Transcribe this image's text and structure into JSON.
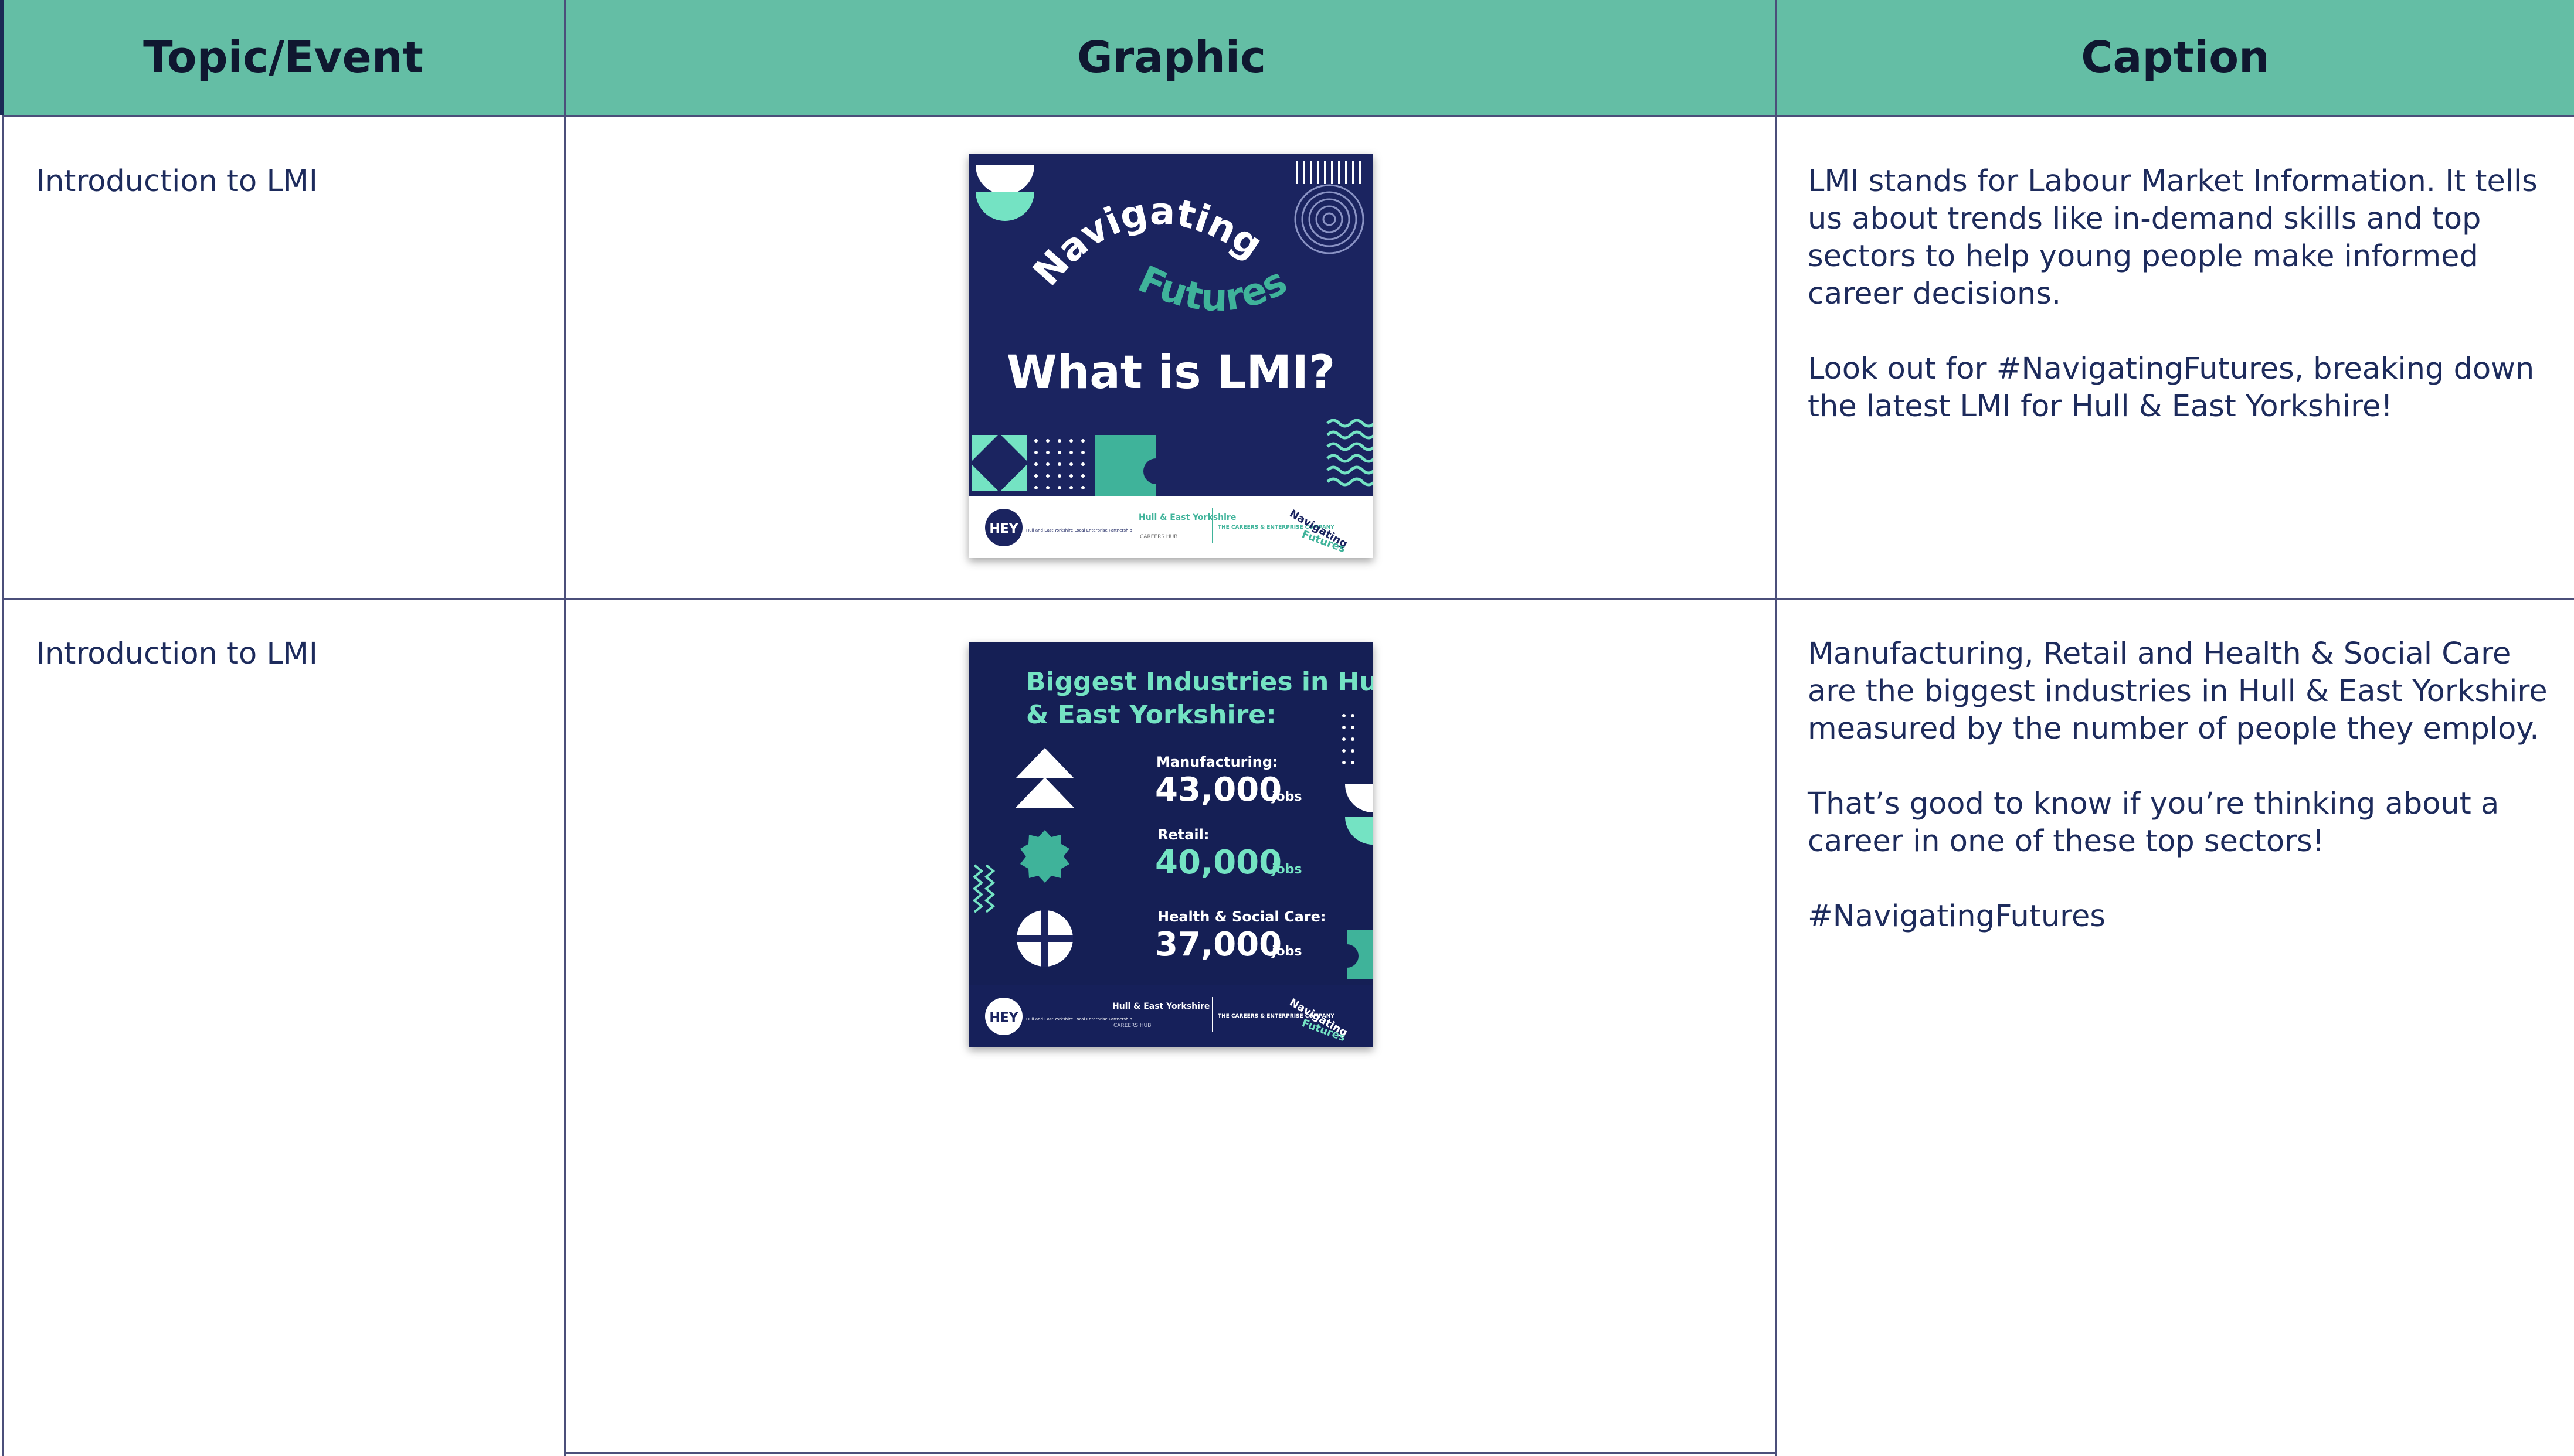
{
  "table": {
    "headers": [
      "Topic/Event",
      "Graphic",
      "Caption"
    ],
    "rows": [
      {
        "topic": "Introduction to LMI",
        "caption": [
          "LMI stands for Labour Market Information. It tells us about trends like in-demand skills and top sectors to help young people make informed career decisions.",
          "Look out for #NavigatingFutures, breaking down the latest LMI for Hull & East Yorkshire!"
        ],
        "graphic": {
          "brand_top": "Navigating",
          "brand_bottom": "Futures",
          "headline": "What is LMI?",
          "footer_logos": [
            "HEY",
            "Hull and East Yorkshire Local Enterprise Partnership",
            "Hull & East Yorkshire",
            "CAREERS HUB",
            "THE CAREERS & ENTERPRISE COMPANY",
            "Navigating",
            "Futures"
          ]
        }
      },
      {
        "topic": "Introduction to LMI",
        "caption": [
          "Manufacturing, Retail and Health & Social Care are the biggest industries in Hull & East Yorkshire measured by the number of people they employ.",
          "That’s good to know if you’re thinking about a career in one of these top sectors!",
          "#NavigatingFutures"
        ],
        "graphic": {
          "title_line1": "Biggest Industries in Hull",
          "title_line2": "& East Yorkshire:",
          "items": [
            {
              "label": "Manufacturing:",
              "value": "43,000",
              "unit": "jobs"
            },
            {
              "label": "Retail:",
              "value": "40,000",
              "unit": "jobs"
            },
            {
              "label": "Health & Social Care:",
              "value": "37,000",
              "unit": "jobs"
            }
          ],
          "footer_logos": [
            "HEY",
            "Hull and East Yorkshire Local Enterprise Partnership",
            "Hull & East Yorkshire",
            "CAREERS HUB",
            "THE CAREERS & ENTERPRISE COMPANY",
            "Navigating",
            "Futures"
          ]
        }
      }
    ]
  },
  "colors": {
    "header_bg": "#64bea5",
    "navy": "#1b2460",
    "mint": "#74e3c3",
    "teal": "#3fb39a",
    "text": "#1d2b5c"
  }
}
